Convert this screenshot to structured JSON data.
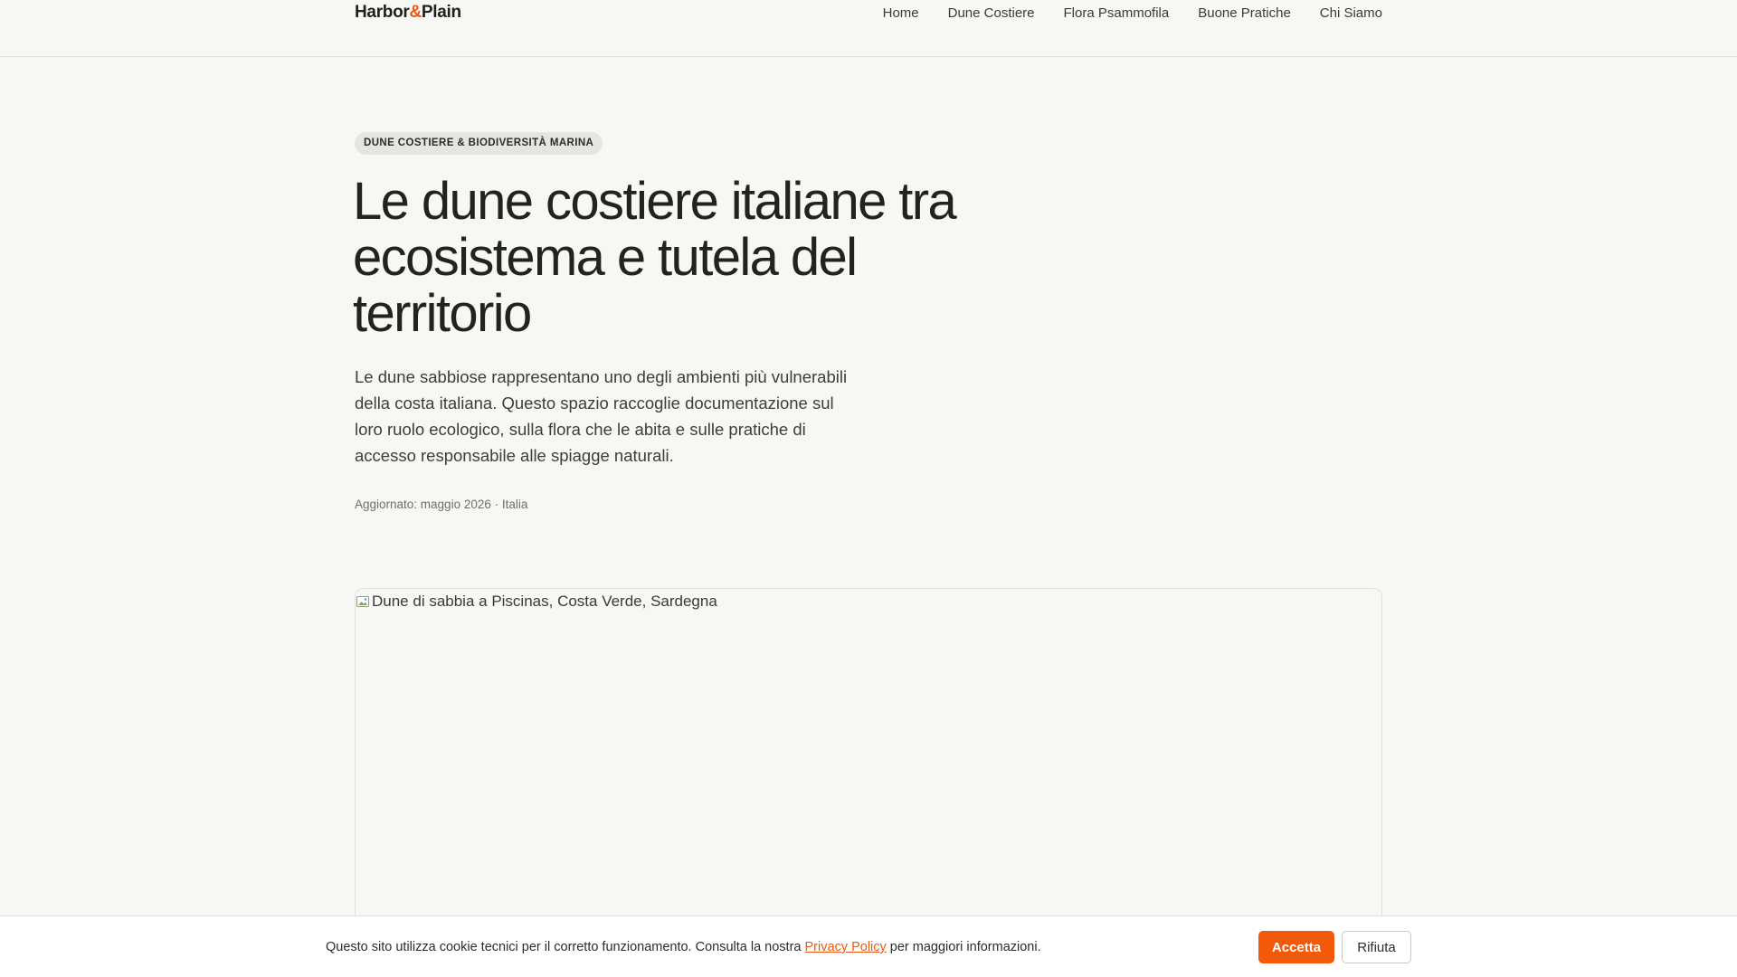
{
  "header": {
    "logo_part1": "Harbor",
    "logo_amp": "&",
    "logo_part2": "Plain",
    "nav": [
      {
        "label": "Home"
      },
      {
        "label": "Dune Costiere"
      },
      {
        "label": "Flora Psammofila"
      },
      {
        "label": "Buone Pratiche"
      },
      {
        "label": "Chi Siamo"
      }
    ]
  },
  "hero": {
    "badge": "DUNE COSTIERE & BIODIVERSITÀ MARINA",
    "title": "Le dune costiere italiane tra ecosistema e tutela del territorio",
    "lead": "Le dune sabbiose rappresentano uno degli ambienti più vulnerabili della costa italiana. Questo spazio raccoglie documentazione sul loro ruolo ecologico, sulla flora che le abita e sulle pratiche di accesso responsabile alle spiagge naturali.",
    "meta": "Aggiornato: maggio 2026 · Italia"
  },
  "image": {
    "alt": "Dune di sabbia a Piscinas, Costa Verde, Sardegna",
    "icon": "broken-image-icon"
  },
  "cookie": {
    "text_before": "Questo sito utilizza cookie tecnici per il corretto funzionamento. Consulta la nostra ",
    "link": "Privacy Policy",
    "text_after": " per maggiori informazioni.",
    "accept": "Accetta",
    "reject": "Rifiuta"
  },
  "colors": {
    "accent": "#f25a0a",
    "background": "#f7f7f4",
    "text": "#1f1f1c"
  }
}
